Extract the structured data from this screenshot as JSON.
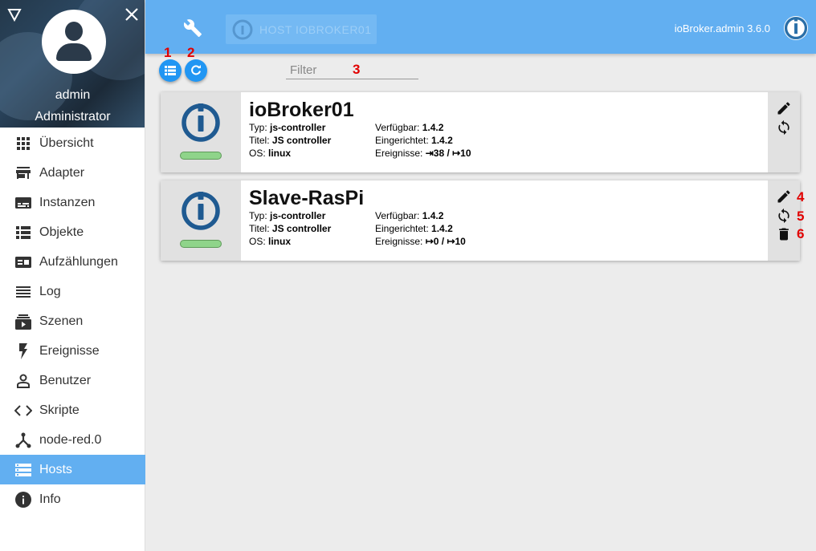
{
  "sidebar": {
    "user": {
      "name": "admin",
      "role": "Administrator"
    },
    "items": [
      {
        "label": "Übersicht",
        "icon": "apps-icon"
      },
      {
        "label": "Adapter",
        "icon": "store-icon"
      },
      {
        "label": "Instanzen",
        "icon": "subtitles-icon"
      },
      {
        "label": "Objekte",
        "icon": "view-list-icon"
      },
      {
        "label": "Aufzählungen",
        "icon": "featured-play-list-icon"
      },
      {
        "label": "Log",
        "icon": "reorder-icon"
      },
      {
        "label": "Szenen",
        "icon": "subscriptions-icon"
      },
      {
        "label": "Ereignisse",
        "icon": "flash-icon"
      },
      {
        "label": "Benutzer",
        "icon": "person-icon"
      },
      {
        "label": "Skripte",
        "icon": "code-icon"
      },
      {
        "label": "node-red.0",
        "icon": "node-red-icon"
      },
      {
        "label": "Hosts",
        "icon": "storage-icon"
      },
      {
        "label": "Info",
        "icon": "info-icon"
      }
    ],
    "active_item": "Hosts"
  },
  "header": {
    "host_selector": "HOST IOBROKER01",
    "version": "ioBroker.admin 3.6.0"
  },
  "toolbar": {
    "filter_placeholder": "Filter"
  },
  "annotations": [
    "1",
    "2",
    "3",
    "4",
    "5",
    "6"
  ],
  "hosts": [
    {
      "name": "ioBroker01",
      "type_label": "Typ:",
      "type": "js-controller",
      "title_label": "Titel:",
      "title": "JS controller",
      "os_label": "OS:",
      "os": "linux",
      "available_label": "Verfügbar:",
      "available": "1.4.2",
      "installed_label": "Eingerichtet:",
      "installed": "1.4.2",
      "events_label": "Ereignisse:",
      "events": "⇥38 / ↦10"
    },
    {
      "name": "Slave-RasPi",
      "type_label": "Typ:",
      "type": "js-controller",
      "title_label": "Titel:",
      "title": "JS controller",
      "os_label": "OS:",
      "os": "linux",
      "available_label": "Verfügbar:",
      "available": "1.4.2",
      "installed_label": "Eingerichtet:",
      "installed": "1.4.2",
      "events_label": "Ereignisse:",
      "events": "↦0 / ↦10"
    }
  ],
  "colors": {
    "primary": "#62aff1",
    "button": "#2196f3",
    "status_ok": "#8fd48a",
    "annotation": "#e10000",
    "logo_blue": "#1f5a91"
  }
}
